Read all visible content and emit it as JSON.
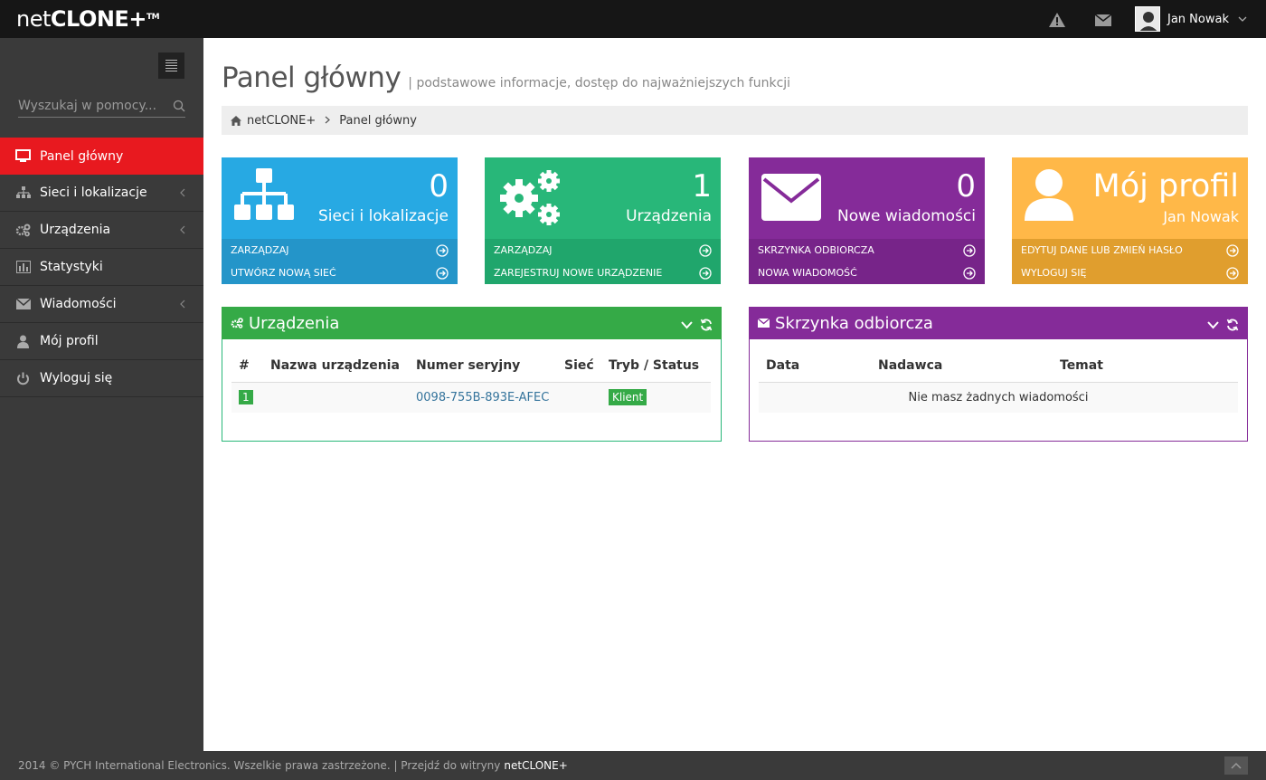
{
  "header": {
    "logo_light": "net",
    "logo_bold": "CLONE+",
    "logo_tm": "TM",
    "user_name": "Jan Nowak",
    "icons": [
      "warning-icon",
      "envelope-icon",
      "avatar",
      "chevron-down-icon"
    ]
  },
  "sidebar": {
    "search_placeholder": "Wyszukaj w pomocy...",
    "items": [
      {
        "label": "Panel główny",
        "icon": "monitor-icon",
        "active": true
      },
      {
        "label": "Sieci i lokalizacje",
        "icon": "sitemap-icon",
        "has_submenu": true
      },
      {
        "label": "Urządzenia",
        "icon": "cogs-icon",
        "has_submenu": true
      },
      {
        "label": "Statystyki",
        "icon": "bar-chart-icon"
      },
      {
        "label": "Wiadomości",
        "icon": "envelope-icon",
        "has_submenu": true
      },
      {
        "label": "Mój profil",
        "icon": "user-icon"
      },
      {
        "label": "Wyloguj się",
        "icon": "power-icon"
      }
    ]
  },
  "main": {
    "title": "Panel główny",
    "subtitle": "| podstawowe informacje, dostęp do najważniejszych funkcji",
    "breadcrumb": [
      "netCLONE+",
      "Panel główny"
    ]
  },
  "tiles": [
    {
      "number": "0",
      "label": "Sieci i lokalizacje",
      "links": [
        "ZARZĄDZAJ",
        "UTWÓRZ NOWĄ SIEĆ"
      ],
      "color": "#27a9e3"
    },
    {
      "number": "1",
      "label": "Urządzenia",
      "links": [
        "ZARZĄDZAJ",
        "ZAREJESTRUJ NOWE URZĄDZENIE"
      ],
      "color": "#28b779"
    },
    {
      "number": "0",
      "label": "Nowe wiadomości",
      "links": [
        "SKRZYNKA ODBIORCZA",
        "NOWA WIADOMOŚĆ"
      ],
      "color": "#852b99"
    },
    {
      "number": "Mój profil",
      "label": "Jan Nowak",
      "links": [
        "EDYTUJ DANE LUB ZMIEŃ HASŁO",
        "WYLOGUJ SIĘ"
      ],
      "color": "#ffb848"
    }
  ],
  "devices_panel": {
    "title": "Urządzenia",
    "columns": [
      "#",
      "Nazwa urządzenia",
      "Numer seryjny",
      "Sieć",
      "Tryb / Status"
    ],
    "rows": [
      {
        "num": "1",
        "name": "",
        "serial": "0098-755B-893E-AFEC",
        "network": "",
        "status": "Klient"
      }
    ]
  },
  "inbox_panel": {
    "title": "Skrzynka odbiorcza",
    "columns": [
      "Data",
      "Nadawca",
      "Temat"
    ],
    "empty_message": "Nie masz żadnych wiadomości"
  },
  "footer": {
    "text": "2014 © PYCH International Electronics. Wszelkie prawa zastrzeżone. | Przejdź do witryny",
    "link": "netCLONE+"
  }
}
